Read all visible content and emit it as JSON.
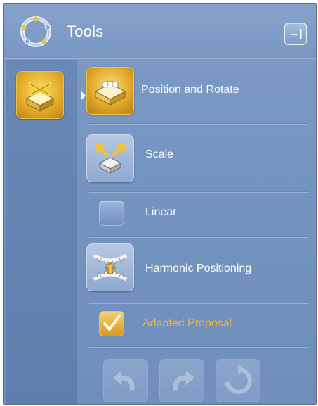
{
  "header": {
    "title": "Tools",
    "logo_icon": "tools-wheel-icon",
    "collapse_icon": "collapse-panel-icon",
    "collapse_glyph": "→|"
  },
  "sidebar": {
    "active_item_icon": "position-rotate-icon"
  },
  "tools": [
    {
      "label": "Position and Rotate",
      "icon": "position-rotate-icon",
      "state": "active"
    },
    {
      "label": "Scale",
      "icon": "scale-icon",
      "state": "normal"
    },
    {
      "label": "Linear",
      "kind": "checkbox",
      "checked": false
    },
    {
      "label": "Harmonic Positioning",
      "icon": "harmonic-positioning-icon",
      "state": "normal"
    },
    {
      "label": "Adapted Proposal",
      "kind": "checkbox",
      "checked": true,
      "color": "#f3b33a"
    }
  ],
  "actions": [
    {
      "icon": "undo-icon",
      "enabled": false
    },
    {
      "icon": "redo-icon",
      "enabled": false
    },
    {
      "icon": "reset-icon",
      "enabled": false
    }
  ],
  "colors": {
    "panel_bg": "#7594c1",
    "accent_gold": "#e3a82a",
    "highlight_text": "#f3b33a"
  }
}
